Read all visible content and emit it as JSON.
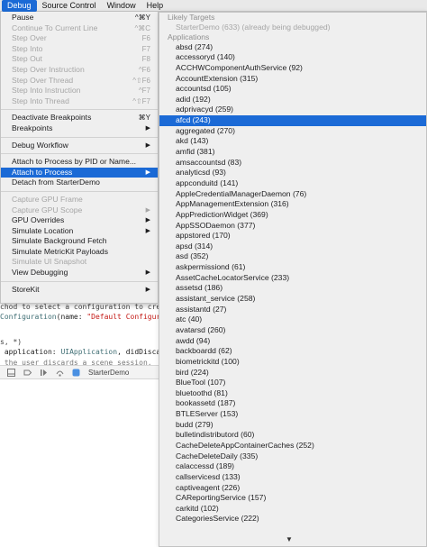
{
  "menubar": {
    "items": [
      "Debug",
      "Source Control",
      "Window",
      "Help"
    ],
    "active_index": 0
  },
  "editor": {
    "line1": "chod to select a configuration to creat",
    "line2_type": "Configuration",
    "line2_rest": "(name: ",
    "line2_str": "\"Default Configurat",
    "line3": "s, *)",
    "line4_pre": " application: ",
    "line4_type": "UIApplication",
    "line4_rest": ", didDiscard",
    "line5": " the user discards a scene session.",
    "debug_target": "StarterDemo"
  },
  "debug_menu": {
    "items": [
      {
        "label": "Pause",
        "shortcut": "^⌘Y",
        "enabled": true
      },
      {
        "label": "Continue To Current Line",
        "shortcut": "^⌘C",
        "enabled": false
      },
      {
        "label": "Step Over",
        "shortcut": "F6",
        "enabled": false
      },
      {
        "label": "Step Into",
        "shortcut": "F7",
        "enabled": false
      },
      {
        "label": "Step Out",
        "shortcut": "F8",
        "enabled": false
      },
      {
        "label": "Step Over Instruction",
        "shortcut": "^F6",
        "enabled": false
      },
      {
        "label": "Step Over Thread",
        "shortcut": "^⇧F6",
        "enabled": false
      },
      {
        "label": "Step Into Instruction",
        "shortcut": "^F7",
        "enabled": false
      },
      {
        "label": "Step Into Thread",
        "shortcut": "^⇧F7",
        "enabled": false
      },
      {
        "separator": true
      },
      {
        "label": "Deactivate Breakpoints",
        "shortcut": "⌘Y",
        "enabled": true
      },
      {
        "label": "Breakpoints",
        "submenu": true,
        "enabled": true
      },
      {
        "separator": true
      },
      {
        "label": "Debug Workflow",
        "submenu": true,
        "enabled": true
      },
      {
        "separator": true
      },
      {
        "label": "Attach to Process by PID or Name...",
        "enabled": true
      },
      {
        "label": "Attach to Process",
        "submenu": true,
        "enabled": true,
        "highlighted": true
      },
      {
        "label": "Detach from StarterDemo",
        "enabled": true
      },
      {
        "separator": true
      },
      {
        "label": "Capture GPU Frame",
        "enabled": false
      },
      {
        "label": "Capture GPU Scope",
        "submenu": true,
        "enabled": false
      },
      {
        "label": "GPU Overrides",
        "submenu": true,
        "enabled": true
      },
      {
        "label": "Simulate Location",
        "submenu": true,
        "enabled": true
      },
      {
        "label": "Simulate Background Fetch",
        "enabled": true
      },
      {
        "label": "Simulate MetricKit Payloads",
        "enabled": true
      },
      {
        "label": "Simulate UI Snapshot",
        "enabled": false
      },
      {
        "label": "View Debugging",
        "submenu": true,
        "enabled": true
      },
      {
        "separator": true
      },
      {
        "label": "StoreKit",
        "submenu": true,
        "enabled": true
      }
    ]
  },
  "attach_submenu": {
    "likely_targets_header": "Likely Targets",
    "likely_targets": [
      {
        "label": "StarterDemo (633) (already being debugged)",
        "enabled": false
      }
    ],
    "applications_header": "Applications",
    "applications": [
      "absd (274)",
      "accessoryd (140)",
      "ACCHWComponentAuthService (92)",
      "AccountExtension (315)",
      "accountsd (105)",
      "adid (192)",
      "adprivacyd (259)",
      "afcd (243)",
      "aggregated (270)",
      "akd (143)",
      "amfid (381)",
      "amsaccountsd (83)",
      "analyticsd (93)",
      "appconduitd (141)",
      "AppleCredentialManagerDaemon (76)",
      "AppManagementExtension (316)",
      "AppPredictionWidget (369)",
      "AppSSODaemon (377)",
      "appstored (170)",
      "apsd (314)",
      "asd (352)",
      "askpermissiond (61)",
      "AssetCacheLocatorService (233)",
      "assetsd (186)",
      "assistant_service (258)",
      "assistantd (27)",
      "atc (40)",
      "avatarsd (260)",
      "awdd (94)",
      "backboardd (62)",
      "biometrickitd (100)",
      "bird (224)",
      "BlueTool (107)",
      "bluetoothd (81)",
      "bookassetd (187)",
      "BTLEServer (153)",
      "budd (279)",
      "bulletindistributord (60)",
      "CacheDeleteAppContainerCaches (252)",
      "CacheDeleteDaily (335)",
      "calaccessd (189)",
      "callservicesd (133)",
      "captiveagent (226)",
      "CAReportingService (157)",
      "carkitd (102)",
      "CategoriesService (222)"
    ],
    "highlighted_index": 7,
    "scroll_indicator": "▼"
  }
}
